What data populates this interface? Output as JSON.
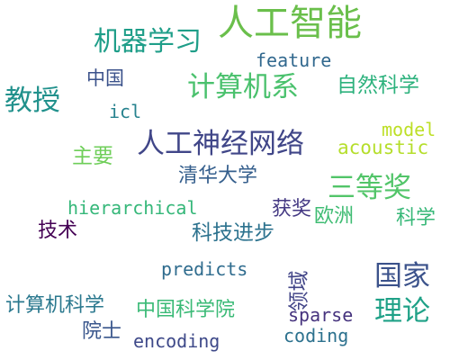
{
  "word_cloud": {
    "words": [
      {
        "id": "w1",
        "text": "人工智能",
        "color": "#6abf4b"
      },
      {
        "id": "w2",
        "text": "机器学习",
        "color": "#1f9e89"
      },
      {
        "id": "w3",
        "text": "feature",
        "color": "#31688e"
      },
      {
        "id": "w4",
        "text": "计算机系",
        "color": "#4ac16d"
      },
      {
        "id": "w5",
        "text": "自然科学",
        "color": "#2db27d"
      },
      {
        "id": "w6",
        "text": "中国",
        "color": "#3b528b"
      },
      {
        "id": "w7",
        "text": "教授",
        "color": "#21918c"
      },
      {
        "id": "w8",
        "text": "icl",
        "color": "#26828e"
      },
      {
        "id": "w9",
        "text": "model",
        "color": "#bddf26"
      },
      {
        "id": "w10",
        "text": "人工神经网络",
        "color": "#404688"
      },
      {
        "id": "w11",
        "text": "acoustic",
        "color": "#b5de2b"
      },
      {
        "id": "w12",
        "text": "主要",
        "color": "#6ece58"
      },
      {
        "id": "w13",
        "text": "清华大学",
        "color": "#355f8d"
      },
      {
        "id": "w14",
        "text": "三等奖",
        "color": "#52c569"
      },
      {
        "id": "w15",
        "text": "hierarchical",
        "color": "#35b779"
      },
      {
        "id": "w16",
        "text": "获奖",
        "color": "#443983"
      },
      {
        "id": "w17",
        "text": "欧洲",
        "color": "#3fbc73"
      },
      {
        "id": "w18",
        "text": "科学",
        "color": "#37b878"
      },
      {
        "id": "w19",
        "text": "技术",
        "color": "#440154"
      },
      {
        "id": "w20",
        "text": "科技进步",
        "color": "#2c728e"
      },
      {
        "id": "w21",
        "text": "predicts",
        "color": "#2f6c8e"
      },
      {
        "id": "w22",
        "text": "领域",
        "color": "#414487"
      },
      {
        "id": "w23",
        "text": "国家",
        "color": "#3b528b"
      },
      {
        "id": "w24",
        "text": "计算机科学",
        "color": "#2a788e"
      },
      {
        "id": "w25",
        "text": "中国科学院",
        "color": "#3aba76"
      },
      {
        "id": "w26",
        "text": "sparse",
        "color": "#46337e"
      },
      {
        "id": "w27",
        "text": "理论",
        "color": "#1fa187"
      },
      {
        "id": "w28",
        "text": "院士",
        "color": "#39568c"
      },
      {
        "id": "w29",
        "text": "encoding",
        "color": "#3e4989"
      },
      {
        "id": "w30",
        "text": "coding",
        "color": "#2c718e"
      }
    ]
  }
}
